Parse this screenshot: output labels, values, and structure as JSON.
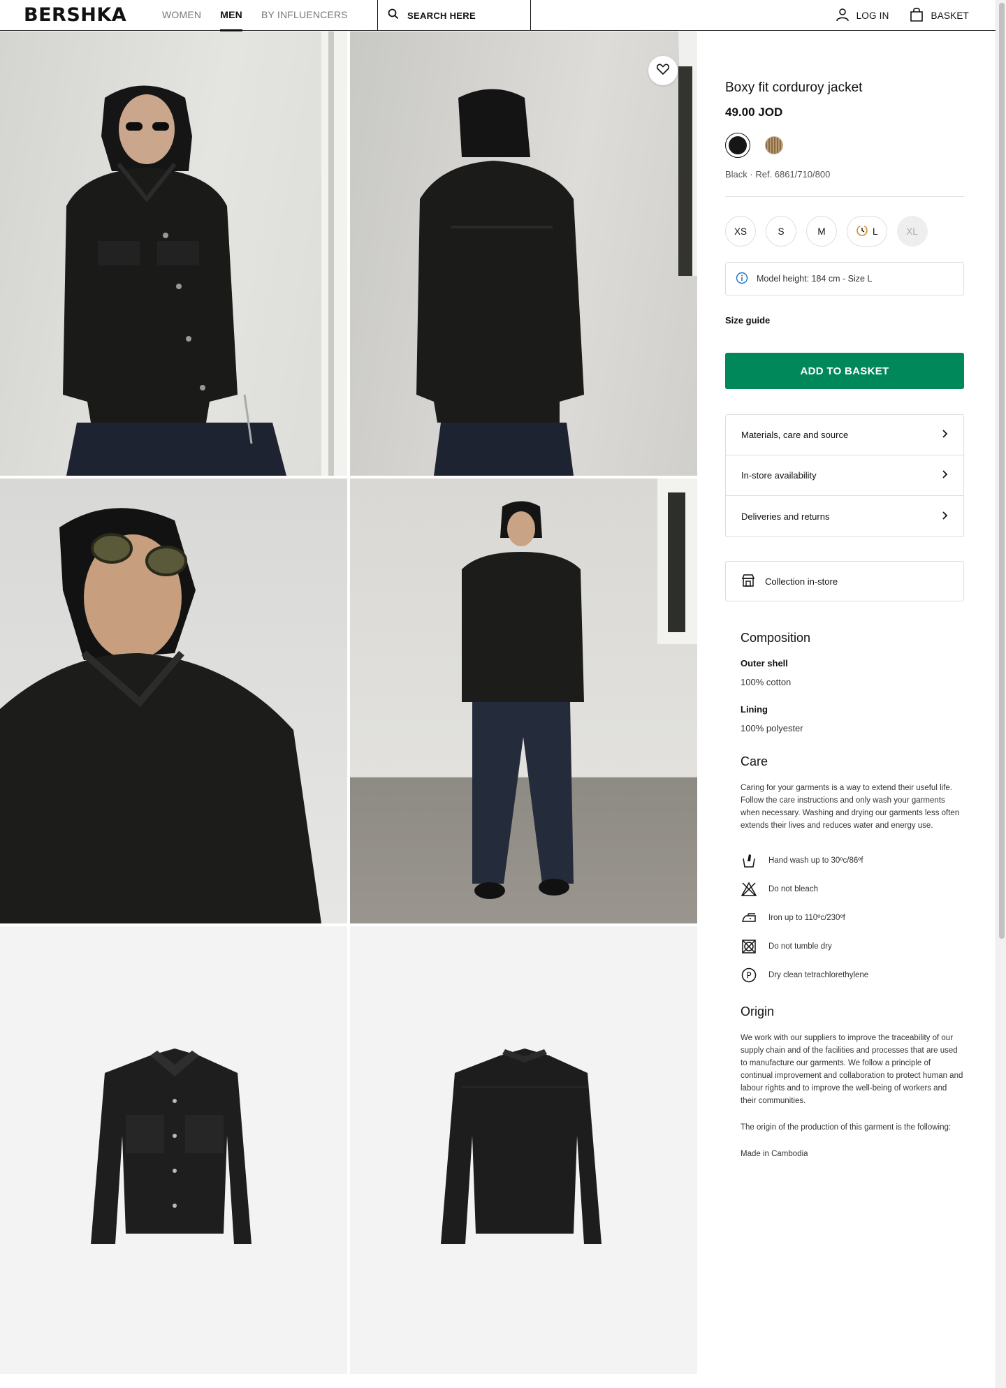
{
  "header": {
    "logo": "BERSHKA",
    "nav": [
      {
        "label": "WOMEN",
        "active": false
      },
      {
        "label": "MEN",
        "active": true
      },
      {
        "label": "BY INFLUENCERS",
        "active": false
      }
    ],
    "search_label": "SEARCH HERE",
    "login_label": "LOG IN",
    "basket_label": "BASKET"
  },
  "product": {
    "title": "Boxy fit corduroy jacket",
    "price": "49.00 JOD",
    "swatches": [
      {
        "name": "Black",
        "color": "#161616",
        "selected": true
      },
      {
        "name": "Brown",
        "color": "#9a7a55",
        "selected": false
      }
    ],
    "color_ref": "Black · Ref. 6861/710/800",
    "sizes": [
      {
        "label": "XS",
        "available": true,
        "low_stock": false
      },
      {
        "label": "S",
        "available": true,
        "low_stock": false
      },
      {
        "label": "M",
        "available": true,
        "low_stock": false
      },
      {
        "label": "L",
        "available": true,
        "low_stock": true
      },
      {
        "label": "XL",
        "available": false,
        "low_stock": false
      }
    ],
    "model_info": "Model height: 184 cm - Size L",
    "size_guide": "Size guide",
    "add_to_basket": "ADD TO BASKET",
    "add_button_color": "#00875a",
    "accordion": [
      {
        "label": "Materials, care and source"
      },
      {
        "label": "In-store availability"
      },
      {
        "label": "Deliveries and returns"
      }
    ],
    "collection_label": "Collection in-store"
  },
  "composition": {
    "heading": "Composition",
    "outer_shell_label": "Outer shell",
    "outer_shell_value": "100% cotton",
    "lining_label": "Lining",
    "lining_value": "100% polyester"
  },
  "care": {
    "heading": "Care",
    "text": "Caring for your garments is a way to extend their useful life. Follow the care instructions and only wash your garments when necessary. Washing and drying our garments less often extends their lives and reduces water and energy use.",
    "items": [
      {
        "icon": "hand-wash-icon",
        "label": "Hand wash up to 30ºc/86ºf"
      },
      {
        "icon": "do-not-bleach-icon",
        "label": "Do not bleach"
      },
      {
        "icon": "iron-icon",
        "label": "Iron up to 110ºc/230ºf"
      },
      {
        "icon": "do-not-tumble-dry-icon",
        "label": "Do not tumble dry"
      },
      {
        "icon": "dry-clean-p-icon",
        "label": "Dry clean tetrachlorethylene"
      }
    ]
  },
  "origin": {
    "heading": "Origin",
    "text": "We work with our suppliers to improve the traceability of our supply chain and of the facilities and processes that are used to manufacture our garments. We follow a principle of continual improvement and collaboration to protect human and labour rights and to improve the well-being of workers and their communities.",
    "text2": "The origin of the production of this garment is the following:",
    "made_in": "Made in Cambodia"
  }
}
